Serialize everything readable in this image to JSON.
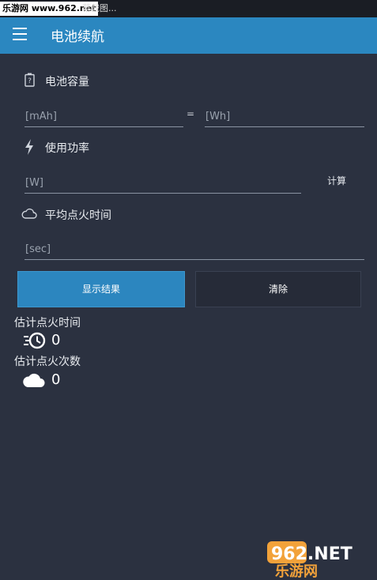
{
  "statusbar": {
    "tag": "乐游网 www.962.net",
    "tail": "幕截图..."
  },
  "appbar": {
    "title": "电池续航"
  },
  "battery": {
    "label": "电池容量",
    "mah_placeholder": "[mAh]",
    "equals": "=",
    "wh_placeholder": "[Wh]"
  },
  "power": {
    "label": "使用功率",
    "w_placeholder": "[W]",
    "calc_label": "计算"
  },
  "ignition": {
    "label": "平均点火时间",
    "sec_placeholder": "[sec]"
  },
  "actions": {
    "show_label": "显示结果",
    "clear_label": "清除"
  },
  "results": {
    "time_label": "估计点火时间",
    "time_value": "0",
    "count_label": "估计点火次数",
    "count_value": "0"
  },
  "watermark": {
    "top": "962.NET",
    "bottom": "乐游网"
  },
  "colors": {
    "accent": "#2b87c0",
    "background": "#2b3140"
  }
}
